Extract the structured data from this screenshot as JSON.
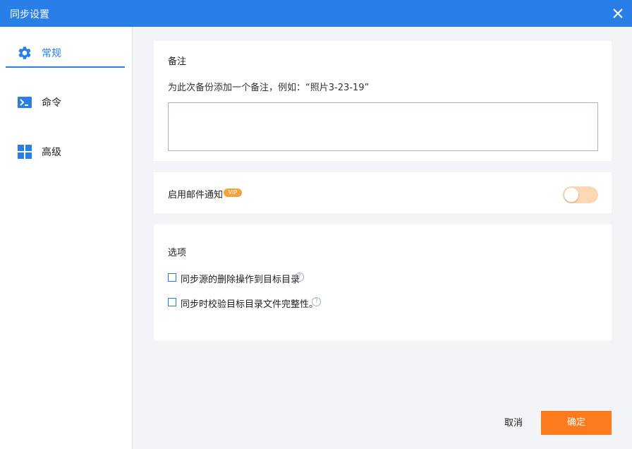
{
  "window": {
    "title": "同步设置"
  },
  "sidebar": {
    "items": [
      {
        "label": "常规",
        "icon": "gear-icon",
        "active": true
      },
      {
        "label": "命令",
        "icon": "terminal-icon",
        "active": false
      },
      {
        "label": "高级",
        "icon": "grid-icon",
        "active": false
      }
    ]
  },
  "note": {
    "title": "备注",
    "description": "为此次备份添加一个备注，例如：“照片3-23-19”",
    "value": "",
    "placeholder": ""
  },
  "email": {
    "label": "启用邮件通知",
    "badge": "VIP",
    "enabled": false
  },
  "options": {
    "title": "选项",
    "items": [
      {
        "label": "同步源的删除操作到目标目录",
        "checked": false
      },
      {
        "label": "同步时校验目标目录文件完整性。",
        "checked": false
      }
    ]
  },
  "footer": {
    "cancel_label": "取消",
    "ok_label": "确定"
  },
  "colors": {
    "accent": "#2a7ee8",
    "primary_button": "#fd7a1c",
    "vip_badge": "#f5a23c",
    "toggle_off": "#fbd8b4"
  }
}
